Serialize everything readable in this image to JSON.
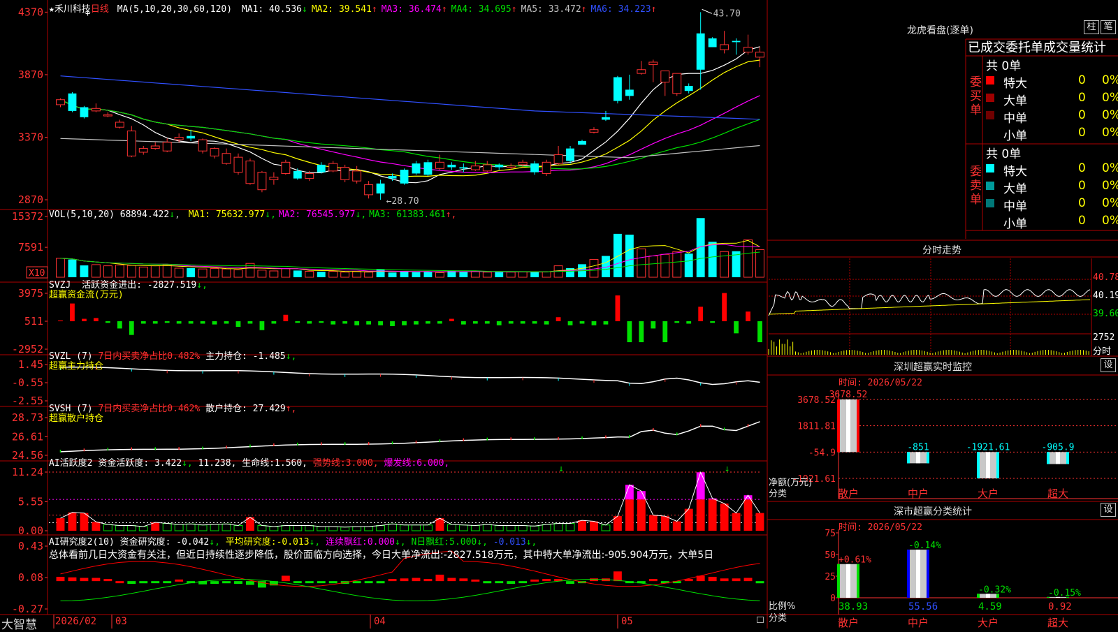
{
  "kline": {
    "stock_name": "禾川科技",
    "period": "日线",
    "ma_header": "MA(5,10,20,30,60,120)",
    "ma": [
      {
        "label": "MA1:",
        "value": "40.536",
        "arrow": "↓",
        "color": "#ffffff"
      },
      {
        "label": "MA2:",
        "value": "39.541",
        "arrow": "↑",
        "color": "#ffff00"
      },
      {
        "label": "MA3:",
        "value": "36.474",
        "arrow": "↑",
        "color": "#ff00ff"
      },
      {
        "label": "MA4:",
        "value": "34.695",
        "arrow": "↑",
        "color": "#00e000"
      },
      {
        "label": "MA5:",
        "value": "33.472",
        "arrow": "↑",
        "color": "#c0c0c0"
      },
      {
        "label": "MA6:",
        "value": "34.223",
        "arrow": "↑",
        "color": "#3050ff"
      }
    ],
    "y_ticks": [
      "4370",
      "3870",
      "3370",
      "2870"
    ],
    "high_label": "43.70",
    "low_label": "28.70",
    "opens": [
      36.3,
      37.2,
      36.1,
      35.8,
      35.4,
      34.5,
      32.2,
      32.5,
      32.8,
      32.6,
      33.5,
      33.8,
      32.6,
      32.2,
      31.6,
      30.9,
      30.0,
      29.5,
      30.3,
      30.8,
      31.0,
      30.4,
      31.5,
      31.0,
      30.3,
      30.2,
      29.1,
      30.0,
      30.6,
      31.1,
      31.6,
      31.7,
      31.2,
      31.5,
      31.3,
      31.1,
      31.0,
      31.5,
      31.3,
      31.5,
      31.6,
      30.8,
      31.6,
      32.8,
      33.4,
      34.1,
      35.3,
      38.5,
      37.5,
      38.8,
      39.5,
      38.1,
      37.2,
      37.8,
      42.0,
      41.6,
      40.7,
      41.4,
      40.5,
      40.1
    ],
    "closes": [
      36.7,
      35.8,
      35.3,
      36.0,
      35.5,
      34.9,
      34.2,
      32.8,
      33.0,
      33.3,
      33.7,
      33.6,
      33.5,
      32.8,
      32.4,
      32.1,
      31.8,
      30.9,
      30.5,
      31.7,
      30.4,
      30.8,
      30.9,
      31.6,
      31.3,
      31.0,
      29.9,
      29.2,
      30.4,
      30.0,
      30.8,
      30.7,
      31.7,
      31.3,
      31.2,
      31.4,
      31.5,
      31.3,
      31.4,
      31.7,
      30.9,
      31.7,
      32.3,
      31.8,
      33.1,
      34.3,
      35.1,
      36.6,
      37.0,
      39.1,
      39.7,
      39.0,
      38.8,
      37.4,
      39.1,
      40.9,
      41.1,
      41.3,
      40.9,
      40.5
    ],
    "highs": [
      36.8,
      37.3,
      36.2,
      36.4,
      35.7,
      35.1,
      34.6,
      33.0,
      33.3,
      33.6,
      34.0,
      34.3,
      33.6,
      32.9,
      32.8,
      32.4,
      32.0,
      31.0,
      30.9,
      31.9,
      31.2,
      31.0,
      31.7,
      31.8,
      31.5,
      31.4,
      30.2,
      30.3,
      30.8,
      31.2,
      31.8,
      31.9,
      32.3,
      31.7,
      31.6,
      31.8,
      31.8,
      31.6,
      31.6,
      31.9,
      31.8,
      31.9,
      33.0,
      33.0,
      33.5,
      34.5,
      35.8,
      38.6,
      38.7,
      39.8,
      39.9,
      38.8,
      38.8,
      38.0,
      43.7,
      41.7,
      42.2,
      41.6,
      41.9,
      40.9
    ],
    "lows": [
      36.1,
      35.7,
      35.2,
      35.7,
      35.3,
      34.4,
      32.1,
      32.3,
      32.7,
      32.5,
      33.3,
      33.4,
      32.4,
      32.0,
      31.5,
      30.7,
      29.9,
      29.3,
      29.9,
      30.7,
      30.3,
      30.2,
      30.8,
      30.9,
      30.1,
      30.0,
      28.8,
      28.7,
      30.2,
      29.9,
      30.7,
      30.6,
      31.1,
      31.1,
      30.9,
      31.0,
      30.9,
      31.1,
      31.1,
      31.3,
      30.7,
      30.6,
      31.5,
      31.6,
      33.3,
      34.0,
      35.0,
      36.4,
      36.7,
      38.7,
      38.1,
      37.0,
      37.0,
      37.2,
      37.5,
      40.9,
      40.4,
      40.3,
      40.3,
      39.3
    ],
    "ma_colors": [
      "#ffffff",
      "#ffff00",
      "#ff00ff",
      "#00e000",
      "#c0c0c0",
      "#3050ff"
    ]
  },
  "volume": {
    "header": "VOL(5,10,20)",
    "value": "68894.422",
    "value_arrow": "↓",
    "ma": [
      {
        "label": "MA1:",
        "value": "75632.977",
        "arrow": "↓",
        "color": "#ffff00"
      },
      {
        "label": "MA2:",
        "value": "76545.977",
        "arrow": "↓",
        "color": "#ff00ff"
      },
      {
        "label": "MA3:",
        "value": "61383.461",
        "arrow": "↑",
        "color": "#00e000"
      }
    ],
    "y_ticks": [
      "15372",
      "7591"
    ],
    "unit": "X10",
    "values": [
      4.8,
      4.5,
      3.0,
      3.2,
      2.9,
      3.1,
      3.0,
      2.6,
      2.9,
      3.2,
      2.3,
      2.3,
      2.1,
      2.2,
      2.1,
      1.9,
      3.5,
      1.8,
      1.6,
      2.2,
      1.7,
      1.5,
      1.4,
      1.5,
      1.3,
      1.5,
      1.3,
      2.0,
      1.2,
      1.4,
      1.3,
      1.4,
      1.2,
      1.6,
      1.5,
      1.5,
      1.3,
      1.3,
      1.3,
      1.4,
      1.3,
      1.4,
      2.9,
      2.3,
      3.3,
      4.5,
      5.4,
      11.0,
      10.8,
      7.2,
      5.4,
      5.8,
      6.5,
      6.0,
      15.0,
      9.0,
      6.5,
      6.6,
      9.5,
      7.0
    ]
  },
  "svzj": {
    "header": "SVZJ",
    "title": "活跃资金进出:",
    "value": "-2827.519",
    "arrow": "↓,",
    "subtitle": "超赢资金流(万元)",
    "y_ticks": [
      "3975",
      "511",
      "-2952"
    ],
    "values": [
      0.1,
      2.2,
      0.3,
      0.4,
      -0.2,
      -0.9,
      -1.7,
      -0.3,
      -0.3,
      -0.2,
      -0.3,
      -0.3,
      -0.3,
      -0.4,
      -0.3,
      -0.7,
      -0.3,
      -1.1,
      -0.3,
      0.8,
      -0.2,
      -0.3,
      -0.2,
      -0.4,
      -0.3,
      -0.5,
      -0.4,
      -0.5,
      -0.6,
      -0.5,
      -0.4,
      -0.3,
      -0.3,
      0.3,
      -0.4,
      -0.3,
      -0.3,
      -0.5,
      -0.3,
      -0.3,
      -0.3,
      -0.4,
      0.5,
      -0.5,
      -0.3,
      -0.5,
      -0.4,
      3.2,
      -2.6,
      -2.6,
      -0.9,
      -2.6,
      -0.2,
      -0.3,
      1.8,
      -0.2,
      3.5,
      -1.5,
      1.2,
      -2.6
    ]
  },
  "svzl": {
    "header": "SVZL (7)",
    "ratio_label": "7日内买卖净占比",
    "ratio_value": "0.482%",
    "title": "主力持仓:",
    "value": "-1.485",
    "arrow": "↓,",
    "subtitle": "超赢主力持仓",
    "y_ticks": [
      "1.45",
      "-0.55",
      "-2.55"
    ]
  },
  "svsh": {
    "header": "SVSH (7)",
    "ratio_label": "7日内买卖净占比",
    "ratio_value": "0.462%",
    "title": "散户持仓:",
    "value": "27.429",
    "arrow": "↑,",
    "subtitle": "超赢散户持仓",
    "y_ticks": [
      "28.73",
      "26.61",
      "24.56"
    ]
  },
  "ai_active": {
    "header": "AI活跃度2",
    "title": "资金活跃度:",
    "value": "3.422",
    "arrow": "↓,",
    "value2": "11.238,",
    "life_label": "生命线:",
    "life_value": "1.560,",
    "strong_label": "强势线:",
    "strong_value": "3.000,",
    "burst_label": "爆发线:",
    "burst_value": "6.000,",
    "y_ticks": [
      "11.24",
      "5.55",
      "0.00"
    ],
    "values": [
      2.4,
      3.5,
      3.4,
      1.7,
      1.2,
      1.0,
      1.0,
      0.8,
      1.6,
      1.4,
      1.2,
      1.3,
      1.1,
      1.2,
      1.3,
      1.0,
      2.6,
      1.0,
      0.8,
      1.0,
      1.0,
      1.0,
      0.8,
      0.8,
      0.7,
      0.8,
      0.8,
      1.0,
      1.3,
      1.1,
      1.1,
      1.1,
      2.4,
      1.2,
      1.1,
      1.0,
      1.2,
      1.0,
      1.0,
      1.0,
      0.9,
      1.2,
      1.4,
      1.4,
      2.0,
      1.8,
      1.1,
      2.8,
      8.8,
      7.6,
      3.0,
      2.8,
      1.8,
      4.2,
      11.2,
      6.2,
      5.2,
      3.4,
      6.8,
      3.4
    ]
  },
  "ai_research": {
    "header": "AI研究度2(10)",
    "title": "资金研究度:",
    "value": "-0.042",
    "arrow": "↓,",
    "avg_label": "平均研究度:",
    "avg_value": "-0.013",
    "red_label": "连续飘红:",
    "red_value": "0.000",
    "n_label": "N日飘红:",
    "n_value": "5.000",
    "extra_value": "-0.013",
    "comment": "总体看前几日大资金有关注，但近日持续性逐步降低，股价面临方向选择，今日大单净流出:-2827.518万元，其中特大单净流出:-905.904万元，大单5日",
    "y_ticks": [
      "0.43",
      "0.08",
      "-0.27"
    ],
    "values": [
      0.08,
      0.07,
      0.06,
      0.06,
      0.04,
      0.0,
      -0.05,
      -0.04,
      -0.03,
      -0.02,
      0.03,
      -0.02,
      -0.06,
      -0.05,
      -0.04,
      -0.05,
      -0.07,
      -0.12,
      -0.08,
      0.1,
      -0.03,
      -0.02,
      -0.03,
      -0.04,
      -0.05,
      -0.03,
      -0.03,
      -0.04,
      0.04,
      0.05,
      0.06,
      0.04,
      0.12,
      0.06,
      0.05,
      0.03,
      -0.04,
      -0.03,
      -0.05,
      -0.02,
      0.03,
      0.04,
      0.04,
      -0.05,
      -0.02,
      0.05,
      0.05,
      0.18,
      -0.03,
      -0.04,
      0.04,
      -0.04,
      -0.03,
      0.04,
      0.1,
      0.08,
      0.05,
      0.05,
      0.06,
      -0.04
    ]
  },
  "bottom_bar": {
    "brand": "大智慧",
    "dates": [
      "2026/02",
      "03",
      "04",
      "05"
    ]
  },
  "dragon_tiger": {
    "title": "龙虎看盘(逐单)",
    "btn_zhu": "柱",
    "btn_bi": "笔",
    "header": "已成交委托单成交量统计",
    "buy_label": "委买单",
    "sell_label": "委卖单",
    "buy_total": "共 0单",
    "sell_total": "共 0单",
    "buy_rows": [
      {
        "label": "特大",
        "count": "0",
        "pct": "0%",
        "color": "#ff0000"
      },
      {
        "label": "大单",
        "count": "0",
        "pct": "0%",
        "color": "#a00000"
      },
      {
        "label": "中单",
        "count": "0",
        "pct": "0%",
        "color": "#700000"
      },
      {
        "label": "小单",
        "count": "0",
        "pct": "0%",
        "color": "#000000"
      }
    ],
    "sell_rows": [
      {
        "label": "特大",
        "count": "0",
        "pct": "0%",
        "color": "#00ffff"
      },
      {
        "label": "大单",
        "count": "0",
        "pct": "0%",
        "color": "#009c9c"
      },
      {
        "label": "中单",
        "count": "0",
        "pct": "0%",
        "color": "#007878"
      },
      {
        "label": "小单",
        "count": "0",
        "pct": "0%",
        "color": "#000000"
      }
    ]
  },
  "intraday": {
    "title": "分时走势",
    "y_ticks": [
      "40.78",
      "40.19",
      "39.60"
    ],
    "vol_label": "2752",
    "time_label": "分时"
  },
  "sz_monitor": {
    "title": "深圳超赢实时监控",
    "btn": "设",
    "time_label": "时间: 2026/05/22",
    "y_ticks": [
      "3678.52",
      "1811.81",
      "-54.9",
      "-1921.61"
    ],
    "axis_label1": "净额(万元)",
    "axis_label2": "分类",
    "categories": [
      "散户",
      "中户",
      "大户",
      "超大"
    ],
    "values": [
      3678.52,
      -851,
      -1921.61,
      -905.9
    ],
    "value_labels": [
      "3678.52",
      "-851",
      "-1921.61",
      "-905.9"
    ]
  },
  "sz_stats": {
    "title": "深市超赢分类统计",
    "btn": "设",
    "time_label": "时间: 2026/05/22",
    "y_ticks": [
      "75",
      "50",
      "25",
      "0"
    ],
    "axis_label1": "比例%",
    "axis_label2": "分类",
    "categories": [
      "散户",
      "中户",
      "大户",
      "超大"
    ],
    "values": [
      38.93,
      55.56,
      4.59,
      0.92
    ],
    "changes": [
      "+0.61%",
      "-0.14%",
      "-0.32%",
      "-0.15%"
    ]
  }
}
